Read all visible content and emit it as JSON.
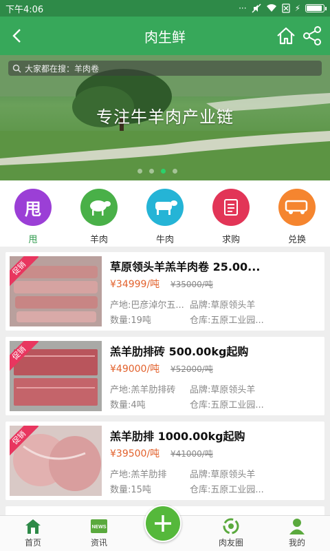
{
  "status_bar": {
    "time": "下午4:06",
    "icons": [
      "signal-icon",
      "mute-icon",
      "wifi-icon",
      "sim-off-icon",
      "battery-icon"
    ]
  },
  "header": {
    "title": "肉生鲜"
  },
  "banner": {
    "search_placeholder": "大家都在搜：羊肉卷",
    "slogan": "专注牛羊肉产业链",
    "active_slide": 3,
    "slide_count": 4
  },
  "categories": [
    {
      "label": "甩",
      "glyph": "甩",
      "color": "#9b3fd6",
      "icon": "shuai-icon",
      "active": true
    },
    {
      "label": "羊肉",
      "color": "#49b048",
      "icon": "sheep-icon",
      "active": false
    },
    {
      "label": "牛肉",
      "color": "#25b4d6",
      "icon": "cow-icon",
      "active": false
    },
    {
      "label": "求购",
      "color": "#e23557",
      "icon": "document-icon",
      "active": false
    },
    {
      "label": "兑换",
      "color": "#f5852f",
      "icon": "truck-icon",
      "active": false
    }
  ],
  "products": [
    {
      "name": "草原领头羊羔羊肉卷 25.00...",
      "price": "¥34999/吨",
      "old_price": "¥35000/吨",
      "origin": "产地:巴彦淖尔五...",
      "brand": "品牌:草原领头羊",
      "quantity": "数量:19吨",
      "warehouse": "仓库:五原工业园...",
      "promo": "促销"
    },
    {
      "name": "羔羊肋排砖 500.00kg起购",
      "price": "¥49000/吨",
      "old_price": "¥52000/吨",
      "origin": "产地:羔羊肋排砖",
      "brand": "品牌:草原领头羊",
      "quantity": "数量:4吨",
      "warehouse": "仓库:五原工业园...",
      "promo": "促销"
    },
    {
      "name": "羔羊肋排 1000.00kg起购",
      "price": "¥39500/吨",
      "old_price": "¥41000/吨",
      "origin": "产地:羔羊肋排",
      "brand": "品牌:草原领头羊",
      "quantity": "数量:15吨",
      "warehouse": "仓库:五原工业园...",
      "promo": "促销"
    }
  ],
  "tabs": [
    {
      "label": "首页",
      "icon": "home-icon"
    },
    {
      "label": "资讯",
      "icon": "news-icon",
      "badge": "NEWS"
    },
    {
      "label": "",
      "icon": "plus-icon"
    },
    {
      "label": "肉友圈",
      "icon": "circle-icon"
    },
    {
      "label": "我的",
      "icon": "user-icon"
    }
  ]
}
